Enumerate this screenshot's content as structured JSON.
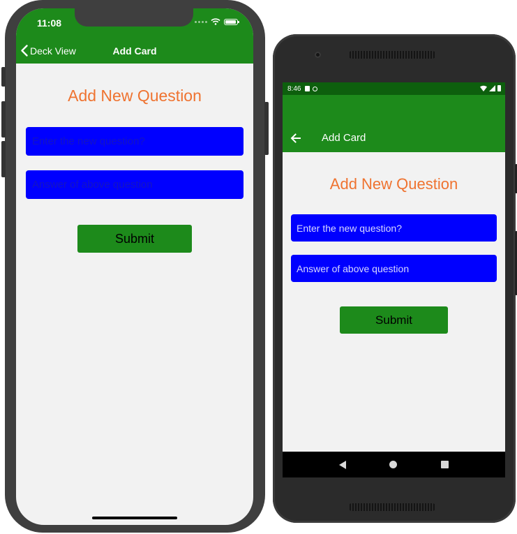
{
  "ios": {
    "status": {
      "time": "11:08"
    },
    "nav": {
      "back_label": "Deck View",
      "title": "Add Card"
    },
    "heading": "Add New Question",
    "question_input": {
      "placeholder": "Enter the new question?",
      "value": ""
    },
    "answer_input": {
      "placeholder": "Answer of above question",
      "value": ""
    },
    "submit_label": "Submit"
  },
  "android": {
    "status": {
      "time": "8:46"
    },
    "appbar": {
      "title": "Add Card"
    },
    "heading": "Add New Question",
    "question_input": {
      "placeholder": "Enter the new question?",
      "value": ""
    },
    "answer_input": {
      "placeholder": "Answer of above question",
      "value": ""
    },
    "submit_label": "Submit"
  },
  "colors": {
    "header_green": "#1d8a1b",
    "status_green_dark": "#0d5f0d",
    "heading_orange": "#ef7330",
    "input_blue": "#0000ff",
    "background": "#f2f2f2"
  }
}
